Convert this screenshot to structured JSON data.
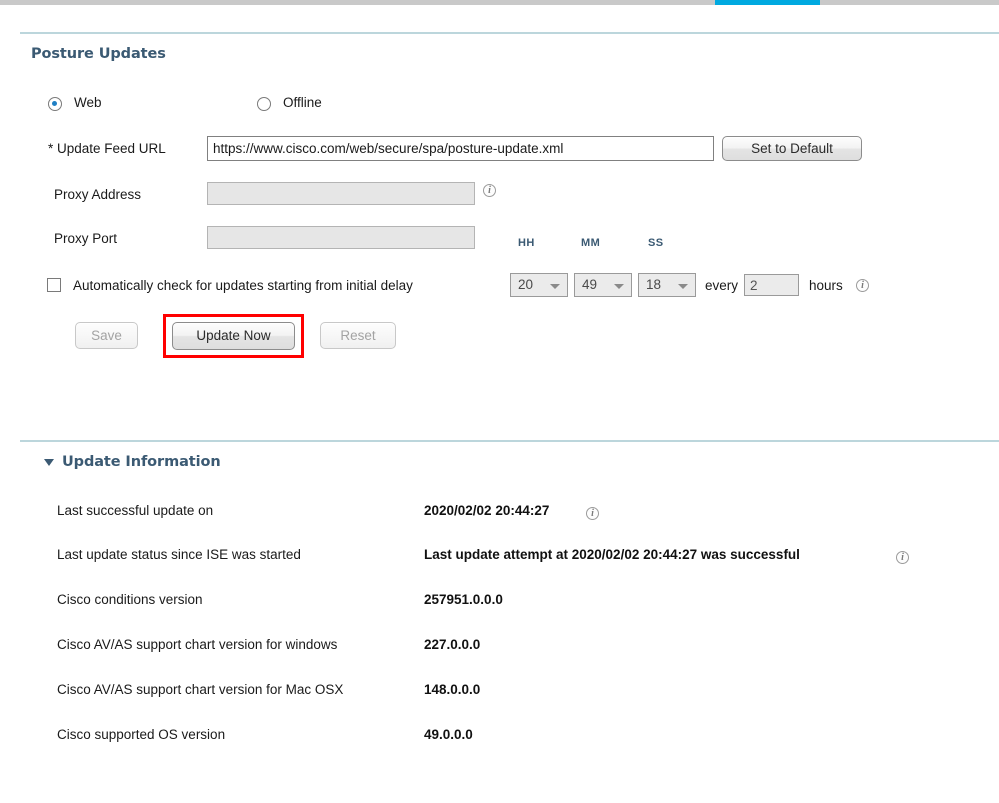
{
  "tabstrip": {
    "active_tab_color": "#00a9e0"
  },
  "section": {
    "posture_title": "Posture Updates",
    "update_info_title": "Update Information"
  },
  "mode": {
    "options": [
      {
        "label": "Web",
        "selected": true
      },
      {
        "label": "Offline",
        "selected": false
      }
    ]
  },
  "form": {
    "feed_url_label": "* Update Feed URL",
    "feed_url_value": "https://www.cisco.com/web/secure/spa/posture-update.xml",
    "feed_url_placeholder": "",
    "set_default_label": "Set to Default",
    "proxy_address_label": "Proxy Address",
    "proxy_address_value": "",
    "proxy_address_placeholder": "",
    "proxy_port_label": "Proxy Port",
    "proxy_port_value": "",
    "proxy_port_placeholder": "",
    "auto_check_label": "Automatically check for updates starting from initial delay",
    "auto_check_checked": false,
    "unit_hh": "HH",
    "unit_mm": "MM",
    "unit_ss": "SS",
    "delay_hh": "20",
    "delay_mm": "49",
    "delay_ss": "18",
    "every_label": "every",
    "every_value": "2",
    "hours_label": "hours",
    "info_glyph": "i"
  },
  "buttons": {
    "save": "Save",
    "update_now": "Update Now",
    "reset": "Reset"
  },
  "highlight": {
    "color": "#ff0000",
    "target": "Update Now"
  },
  "update_information": {
    "rows": [
      {
        "label": "Last successful update on",
        "value": "2020/02/02 20:44:27",
        "has_info": true
      },
      {
        "label": "Last update status since ISE was started",
        "value": "Last update attempt at 2020/02/02 20:44:27 was successful",
        "has_info": true
      },
      {
        "label": "Cisco conditions version",
        "value": "257951.0.0.0",
        "has_info": false
      },
      {
        "label": "Cisco AV/AS support chart version for windows",
        "value": "227.0.0.0",
        "has_info": false
      },
      {
        "label": "Cisco AV/AS support chart version for Mac OSX",
        "value": "148.0.0.0",
        "has_info": false
      },
      {
        "label": "Cisco supported OS version",
        "value": "49.0.0.0",
        "has_info": false
      }
    ]
  }
}
